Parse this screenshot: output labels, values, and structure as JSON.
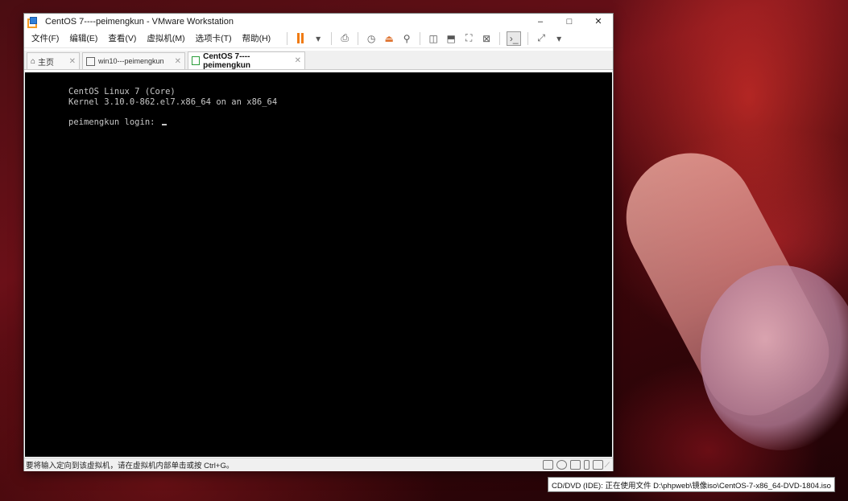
{
  "window": {
    "title": "CentOS 7----peimengkun - VMware Workstation",
    "minimize": "–",
    "maximize": "□",
    "close": "✕"
  },
  "menu": [
    {
      "label": "文件(F)"
    },
    {
      "label": "编辑(E)"
    },
    {
      "label": "查看(V)"
    },
    {
      "label": "虚拟机(M)"
    },
    {
      "label": "选项卡(T)"
    },
    {
      "label": "帮助(H)"
    }
  ],
  "tabs": [
    {
      "label": "主页",
      "close": "✕",
      "icon": "home-icon"
    },
    {
      "label": "win10---peimengkun",
      "close": "✕",
      "icon": "vm-icon"
    },
    {
      "label": "CentOS 7----peimengkun",
      "close": "✕",
      "icon": "vm-running-icon"
    }
  ],
  "console": {
    "line1": "CentOS Linux 7 (Core)",
    "line2": "Kernel 3.10.0-862.el7.x86_64 on an x86_64",
    "login_prompt": "peimengkun login: "
  },
  "status": {
    "text": "要将输入定向到该虚拟机，请在虚拟机内部单击或按 Ctrl+G。"
  },
  "tooltip": {
    "text": "CD/DVD (IDE): 正在使用文件 D:\\phpweb\\镜像iso\\CentOS-7-x86_64-DVD-1804.iso"
  },
  "colors": {
    "accent": "#f07b13",
    "console_bg": "#000000",
    "console_fg": "#c8c8c8"
  }
}
